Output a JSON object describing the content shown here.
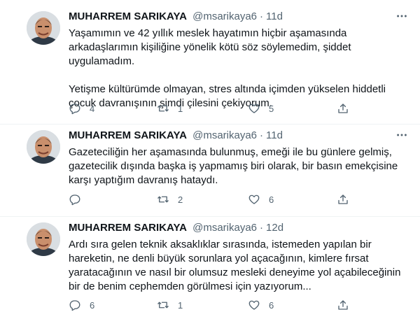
{
  "tweets": [
    {
      "name": "MUHARREM SARIKAYA",
      "handle": "@msarikaya6",
      "dot": "·",
      "time": "11d",
      "text": "Yaşamımın ve 42 yıllık meslek hayatımın hiçbir aşamasında arkadaşlarımın kişiliğine yönelik kötü söz söylemedim, şiddet uygulamadım.\n\nYetişme kültürümde olmayan, stres altında içimden yükselen hiddetli çocuk davranışının şimdi çilesini çekiyorum.",
      "replies": "4",
      "retweets": "1",
      "likes": "5"
    },
    {
      "name": "MUHARREM SARIKAYA",
      "handle": "@msarikaya6",
      "dot": "·",
      "time": "11d",
      "text": "Gazeteciliğin her aşamasında bulunmuş, emeği ile bu günlere gelmiş, gazetecilik dışında başka iş yapmamış biri olarak, bir basın emekçisine karşı yaptığım davranış hataydı.",
      "replies": "",
      "retweets": "2",
      "likes": "6"
    },
    {
      "name": "MUHARREM SARIKAYA",
      "handle": "@msarikaya6",
      "dot": "·",
      "time": "12d",
      "text": "Ardı sıra gelen teknik aksaklıklar sırasında, istemeden yapılan bir hareketin, ne denli büyük sorunlara yol açacağının, kimlere fırsat yaratacağının ve nasıl bir olumsuz mesleki deneyime yol açabileceğinin bir de benim cephemden görülmesi için yazıyorum...",
      "replies": "6",
      "retweets": "1",
      "likes": "6"
    }
  ],
  "icons": {
    "reply": "reply-icon",
    "retweet": "retweet-icon",
    "like": "heart-icon",
    "share": "share-icon",
    "more": "more-icon"
  }
}
